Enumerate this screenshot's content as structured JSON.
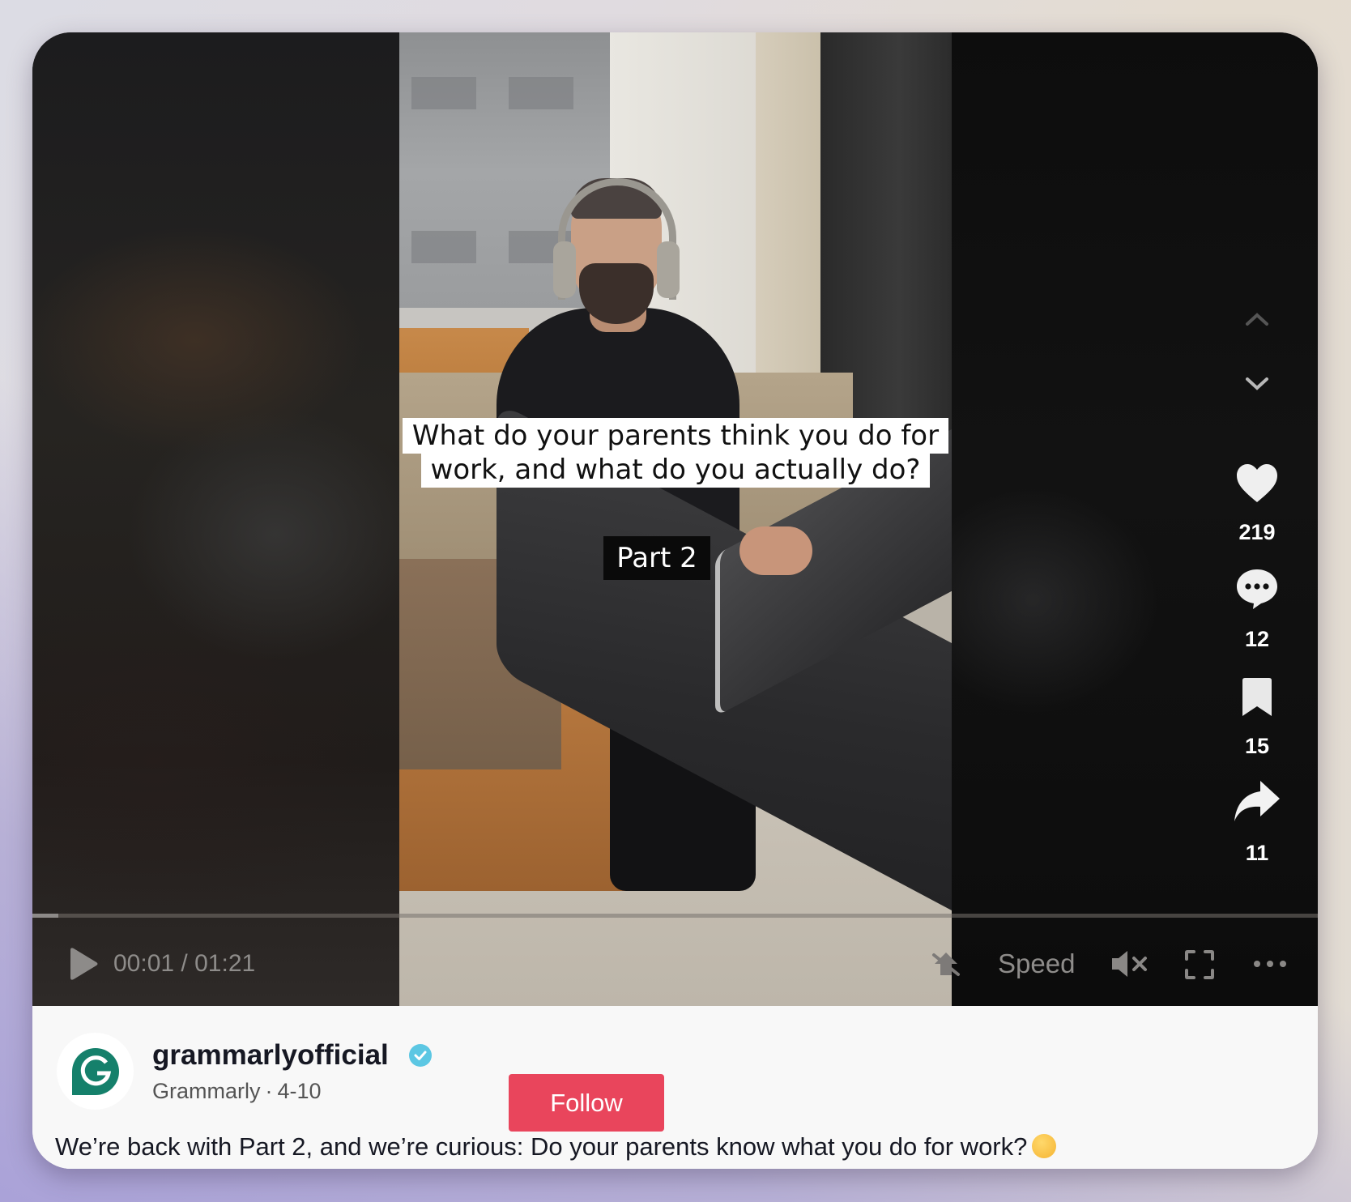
{
  "video": {
    "overlay_caption": "What do your parents think you do for work, and what do you actually do?",
    "overlay_part_label": "Part 2",
    "playback": {
      "current_time": "00:01",
      "separator": "/",
      "duration": "01:21",
      "progress_fraction": 0.012
    },
    "controls": {
      "play_icon": "play-icon",
      "pip_icon": "floating-player-off-icon",
      "speed_label": "Speed",
      "mute_icon": "volume-muted-icon",
      "fullscreen_icon": "fullscreen-icon",
      "more_icon": "more-horizontal-icon"
    }
  },
  "actions": {
    "nav_up_icon": "chevron-up-icon",
    "nav_down_icon": "chevron-down-icon",
    "like": {
      "icon": "heart-icon",
      "count": "219"
    },
    "comment": {
      "icon": "comment-icon",
      "count": "12"
    },
    "save": {
      "icon": "bookmark-icon",
      "count": "15"
    },
    "share": {
      "icon": "share-icon",
      "count": "11"
    }
  },
  "author": {
    "username": "grammarlyofficial",
    "verified": true,
    "display_name": "Grammarly",
    "date_separator": "·",
    "posted_date": "4-10",
    "follow_label": "Follow"
  },
  "description": {
    "text": "We’re back with Part 2, and we’re curious: Do your parents know what you do for work?",
    "emoji": "thinking-face-emoji"
  },
  "colors": {
    "follow_button": "#e9455c",
    "verified_badge": "#5cc7e3",
    "grammarly_green": "#15806b"
  }
}
